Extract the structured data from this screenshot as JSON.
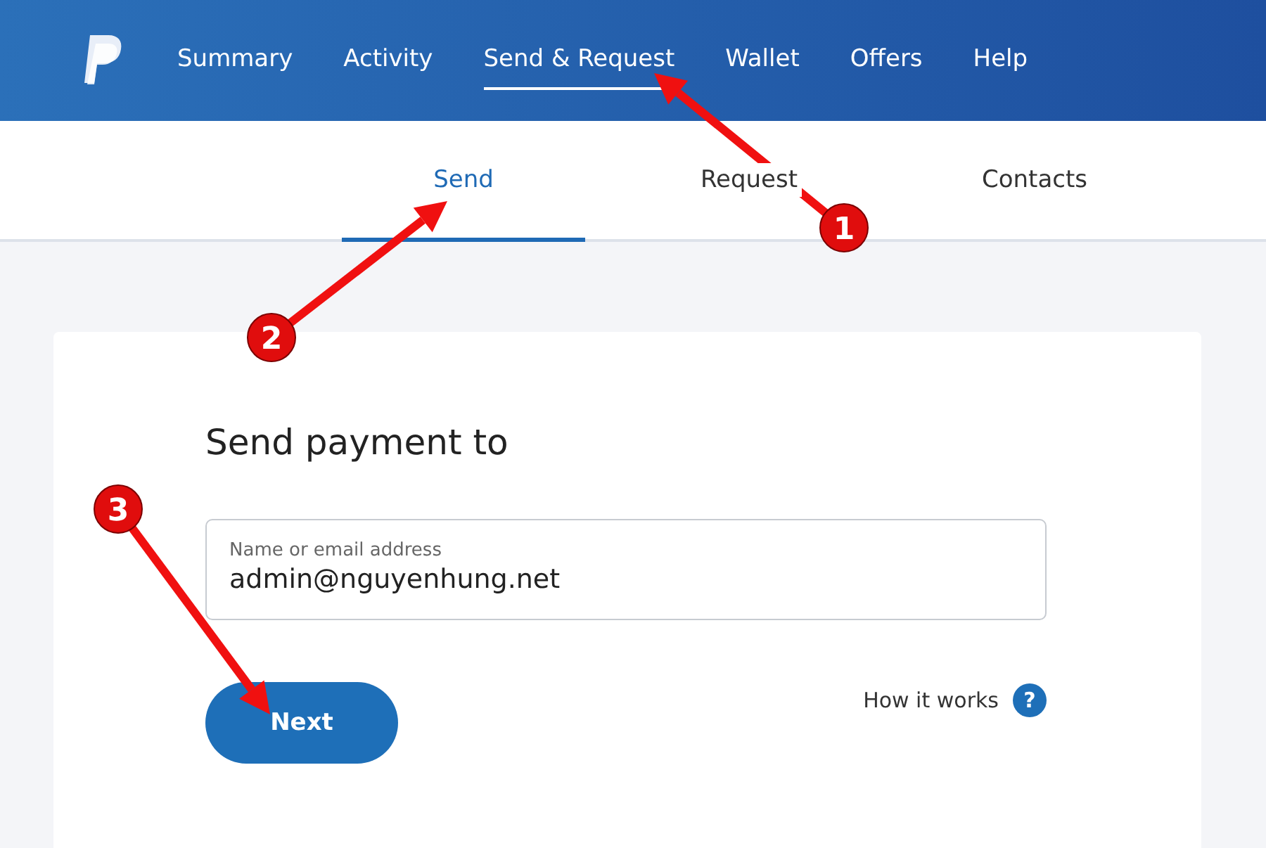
{
  "nav": {
    "items": [
      {
        "label": "Summary",
        "selected": false
      },
      {
        "label": "Activity",
        "selected": false
      },
      {
        "label": "Send & Request",
        "selected": true
      },
      {
        "label": "Wallet",
        "selected": false
      },
      {
        "label": "Offers",
        "selected": false
      },
      {
        "label": "Help",
        "selected": false
      }
    ]
  },
  "tabs": [
    {
      "label": "Send",
      "selected": true
    },
    {
      "label": "Request",
      "selected": false
    },
    {
      "label": "Contacts",
      "selected": false
    }
  ],
  "card": {
    "title": "Send payment to",
    "recipient_field": {
      "label": "Name or email address",
      "value": "admin@nguyenhung.net"
    },
    "next_button": "Next",
    "how_it_works": {
      "label": "How it works",
      "icon_glyph": "?"
    }
  },
  "annotations": [
    {
      "label": "1"
    },
    {
      "label": "2"
    },
    {
      "label": "3"
    }
  ]
}
